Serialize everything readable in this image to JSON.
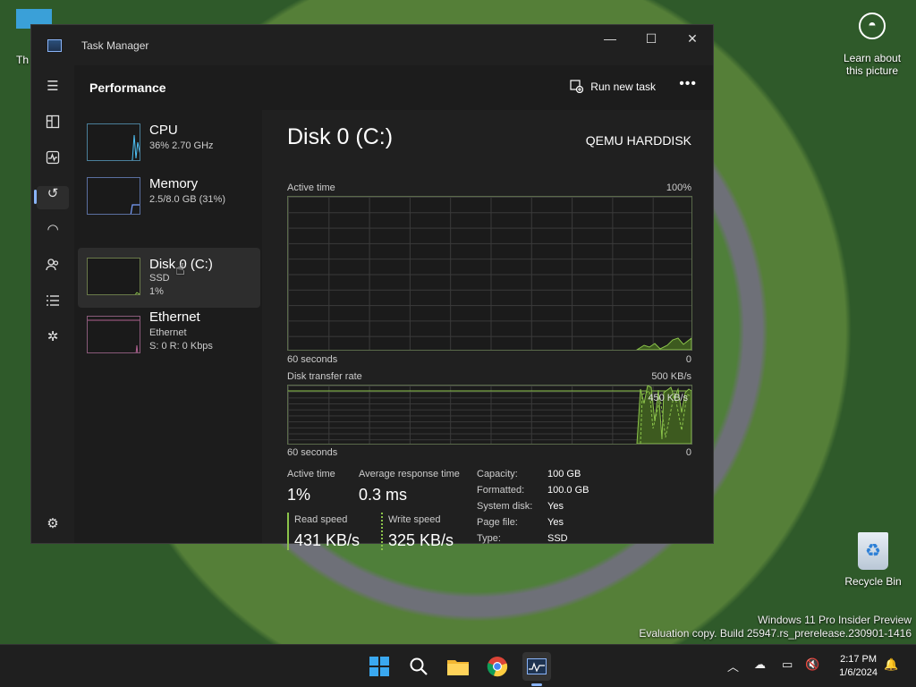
{
  "desktop": {
    "top_left_label": "Th",
    "spotlight": {
      "label_line1": "Learn about",
      "label_line2": "this picture"
    },
    "recycle_bin": {
      "label": "Recycle Bin"
    },
    "watermark": {
      "line1": "Windows 11 Pro Insider Preview",
      "line2": "Evaluation copy. Build 25947.rs_prerelease.230901-1416"
    }
  },
  "window": {
    "title": "Task Manager",
    "controls": {
      "minimize": "—",
      "maximize": "☐",
      "close": "✕"
    }
  },
  "nav_icons": [
    "hamburger-icon",
    "processes-icon",
    "performance-icon",
    "app-history-icon",
    "startup-apps-icon",
    "users-icon",
    "details-icon",
    "services-icon",
    "settings-icon"
  ],
  "header": {
    "title": "Performance",
    "run_new_task": "Run new task",
    "more": "•••"
  },
  "sidebar": {
    "cpu": {
      "name": "CPU",
      "sub": "36%  2.70 GHz"
    },
    "memory": {
      "name": "Memory",
      "sub": "2.5/8.0 GB (31%)"
    },
    "disk": {
      "name": "Disk 0 (C:)",
      "sub1": "SSD",
      "sub2": "1%"
    },
    "ethernet": {
      "name": "Ethernet",
      "sub1": "Ethernet",
      "sub2": "S: 0  R: 0 Kbps"
    }
  },
  "detail": {
    "title": "Disk 0 (C:)",
    "model": "QEMU HARDDISK",
    "active_time_graph": {
      "label": "Active time",
      "max": "100%",
      "x_left": "60 seconds",
      "x_right": "0"
    },
    "transfer_graph": {
      "label": "Disk transfer rate",
      "max": "500 KB/s",
      "marker": "450 KB/s",
      "x_left": "60 seconds",
      "x_right": "0"
    },
    "stats": {
      "active_time": {
        "label": "Active time",
        "value": "1%"
      },
      "avg_response": {
        "label": "Average response time",
        "value": "0.3 ms"
      },
      "read_speed": {
        "label": "Read speed",
        "value": "431 KB/s"
      },
      "write_speed": {
        "label": "Write speed",
        "value": "325 KB/s"
      }
    },
    "props": [
      {
        "k": "Capacity:",
        "v": "100 GB"
      },
      {
        "k": "Formatted:",
        "v": "100.0 GB"
      },
      {
        "k": "System disk:",
        "v": "Yes"
      },
      {
        "k": "Page file:",
        "v": "Yes"
      },
      {
        "k": "Type:",
        "v": "SSD"
      }
    ]
  },
  "taskbar": {
    "clock": {
      "time": "2:17 PM",
      "date": "1/6/2024"
    },
    "apps": [
      "start-icon",
      "search-icon",
      "file-explorer-icon",
      "chrome-icon",
      "task-manager-icon"
    ]
  },
  "colors": {
    "accent": "#8ab4f8",
    "disk_green": "#8bc34a",
    "window_bg": "#202020"
  }
}
